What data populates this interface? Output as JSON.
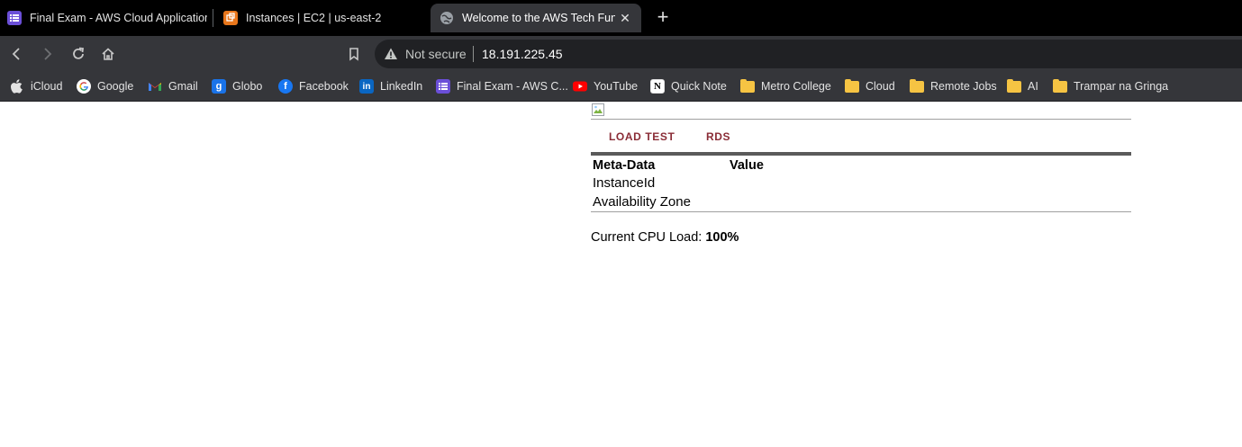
{
  "browser": {
    "tabs": [
      {
        "title": "Final Exam - AWS Cloud Application",
        "icon": "list-icon",
        "active": false
      },
      {
        "title": "Instances | EC2 | us-east-2",
        "icon": "aws-ec2-icon",
        "active": false
      },
      {
        "title": "Welcome to the AWS Tech Fund",
        "icon": "globe-icon",
        "active": true
      }
    ],
    "address_bar": {
      "security_label": "Not secure",
      "url": "18.191.225.45"
    },
    "bookmarks": [
      {
        "label": "iCloud",
        "icon": "apple-icon"
      },
      {
        "label": "Google",
        "icon": "google-icon"
      },
      {
        "label": "Gmail",
        "icon": "gmail-icon"
      },
      {
        "label": "Globo",
        "icon": "globo-icon"
      },
      {
        "label": "Facebook",
        "icon": "facebook-icon"
      },
      {
        "label": "LinkedIn",
        "icon": "linkedin-icon"
      },
      {
        "label": "Final Exam - AWS C...",
        "icon": "list-icon"
      },
      {
        "label": "YouTube",
        "icon": "youtube-icon"
      },
      {
        "label": "Quick Note",
        "icon": "notion-icon"
      },
      {
        "label": "Metro College",
        "icon": "folder-icon"
      },
      {
        "label": "Cloud",
        "icon": "folder-icon"
      },
      {
        "label": "Remote Jobs",
        "icon": "folder-icon"
      },
      {
        "label": "AI",
        "icon": "folder-icon"
      },
      {
        "label": "Trampar na Gringa",
        "icon": "folder-icon"
      }
    ]
  },
  "page": {
    "nav": {
      "load_test": "LOAD TEST",
      "rds": "RDS"
    },
    "meta_table": {
      "header_key": "Meta-Data",
      "header_value": "Value",
      "rows": [
        {
          "key": "InstanceId",
          "value": ""
        },
        {
          "key": "Availability Zone",
          "value": ""
        }
      ]
    },
    "cpu": {
      "label": "Current CPU Load: ",
      "value": "100%"
    }
  }
}
